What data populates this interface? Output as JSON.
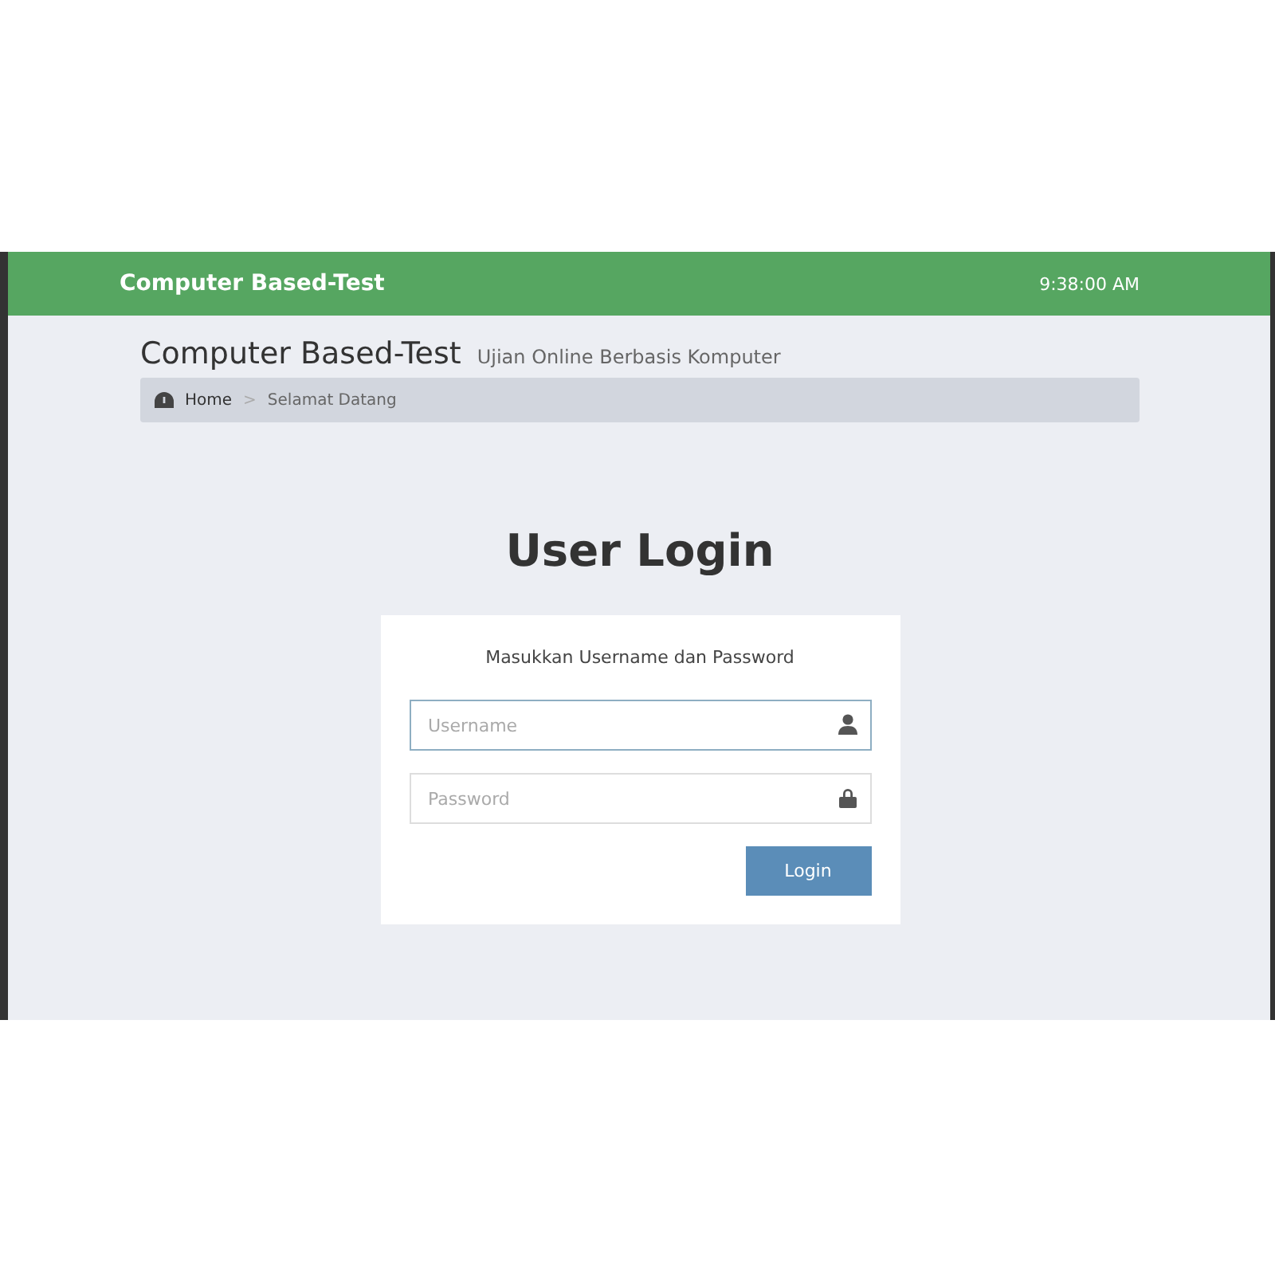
{
  "navbar": {
    "brand": "Computer Based-Test",
    "clock": "9:38:00 AM"
  },
  "header": {
    "title": "Computer Based-Test",
    "subtitle": "Ujian Online Berbasis Komputer"
  },
  "breadcrumb": [
    {
      "label": "Home",
      "kind": "home"
    },
    {
      "label": "Selamat Datang",
      "kind": "current"
    }
  ],
  "breadcrumb_separator": ">",
  "login": {
    "heading": "User Login",
    "instruction": "Masukkan Username dan Password",
    "fields": [
      {
        "placeholder": "Username",
        "kind": "user",
        "focused": true
      },
      {
        "placeholder": "Password",
        "kind": "password",
        "focused": false
      }
    ],
    "button": "Login"
  }
}
